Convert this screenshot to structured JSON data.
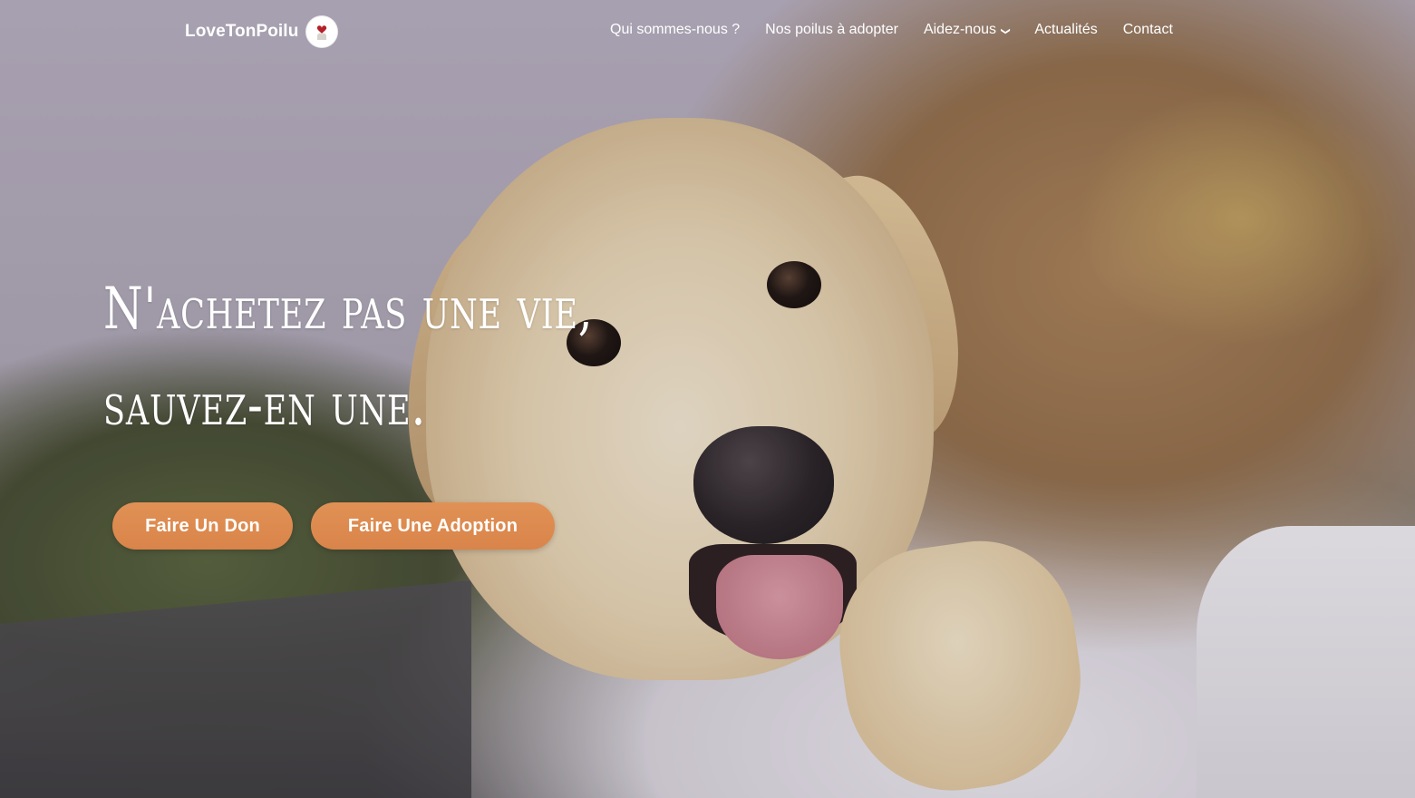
{
  "brand": {
    "name": "LoveTonPoilu",
    "logo_icon": "heart-dog-logo-icon"
  },
  "nav": {
    "items": [
      {
        "label": "Qui sommes-nous ?"
      },
      {
        "label": "Nos poilus à adopter"
      },
      {
        "label": "Aidez-nous",
        "has_dropdown": true
      },
      {
        "label": "Actualités"
      },
      {
        "label": "Contact"
      }
    ]
  },
  "hero": {
    "headline_line1": "N'achetez pas une vie,",
    "headline_line2": "sauvez-en une.",
    "buttons": {
      "donate": "Faire Un Don",
      "adopt": "Faire Une Adoption"
    }
  },
  "colors": {
    "accent": "#dd8a4f",
    "text": "#ffffff"
  }
}
